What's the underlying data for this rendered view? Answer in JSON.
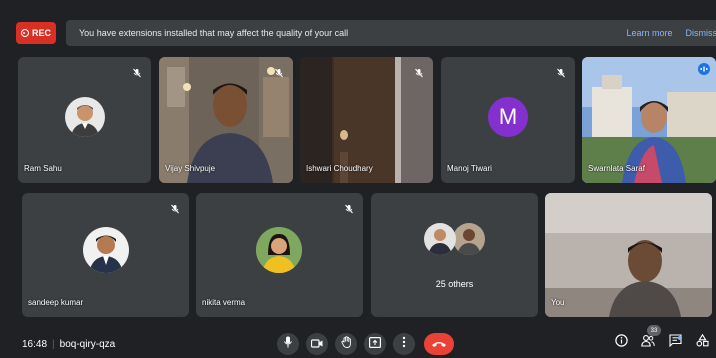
{
  "banner": {
    "rec_label": "REC",
    "message": "You have extensions installed that may affect the quality of your call",
    "learn_more": "Learn more",
    "dismiss": "Dismiss"
  },
  "participants": {
    "ram": "Ram Sahu",
    "vijay": "Vijay Shivpuje",
    "ishwari": "Ishwari Choudhary",
    "manoj": "Manoj Tiwari",
    "manoj_initial": "M",
    "swarnlata": "Swarnlata Saraf",
    "sandeep": "sandeep kumar",
    "nikita": "nikita verma",
    "others": "25 others",
    "you": "You"
  },
  "footer": {
    "time": "16:48",
    "meeting_code": "boq-qiry-qza",
    "people_count": "33"
  },
  "colors": {
    "rec": "#d93025",
    "hangup": "#ea4335",
    "link": "#8ab4f8",
    "manoj_avatar": "#8430ce",
    "tile": "#3c4043"
  }
}
